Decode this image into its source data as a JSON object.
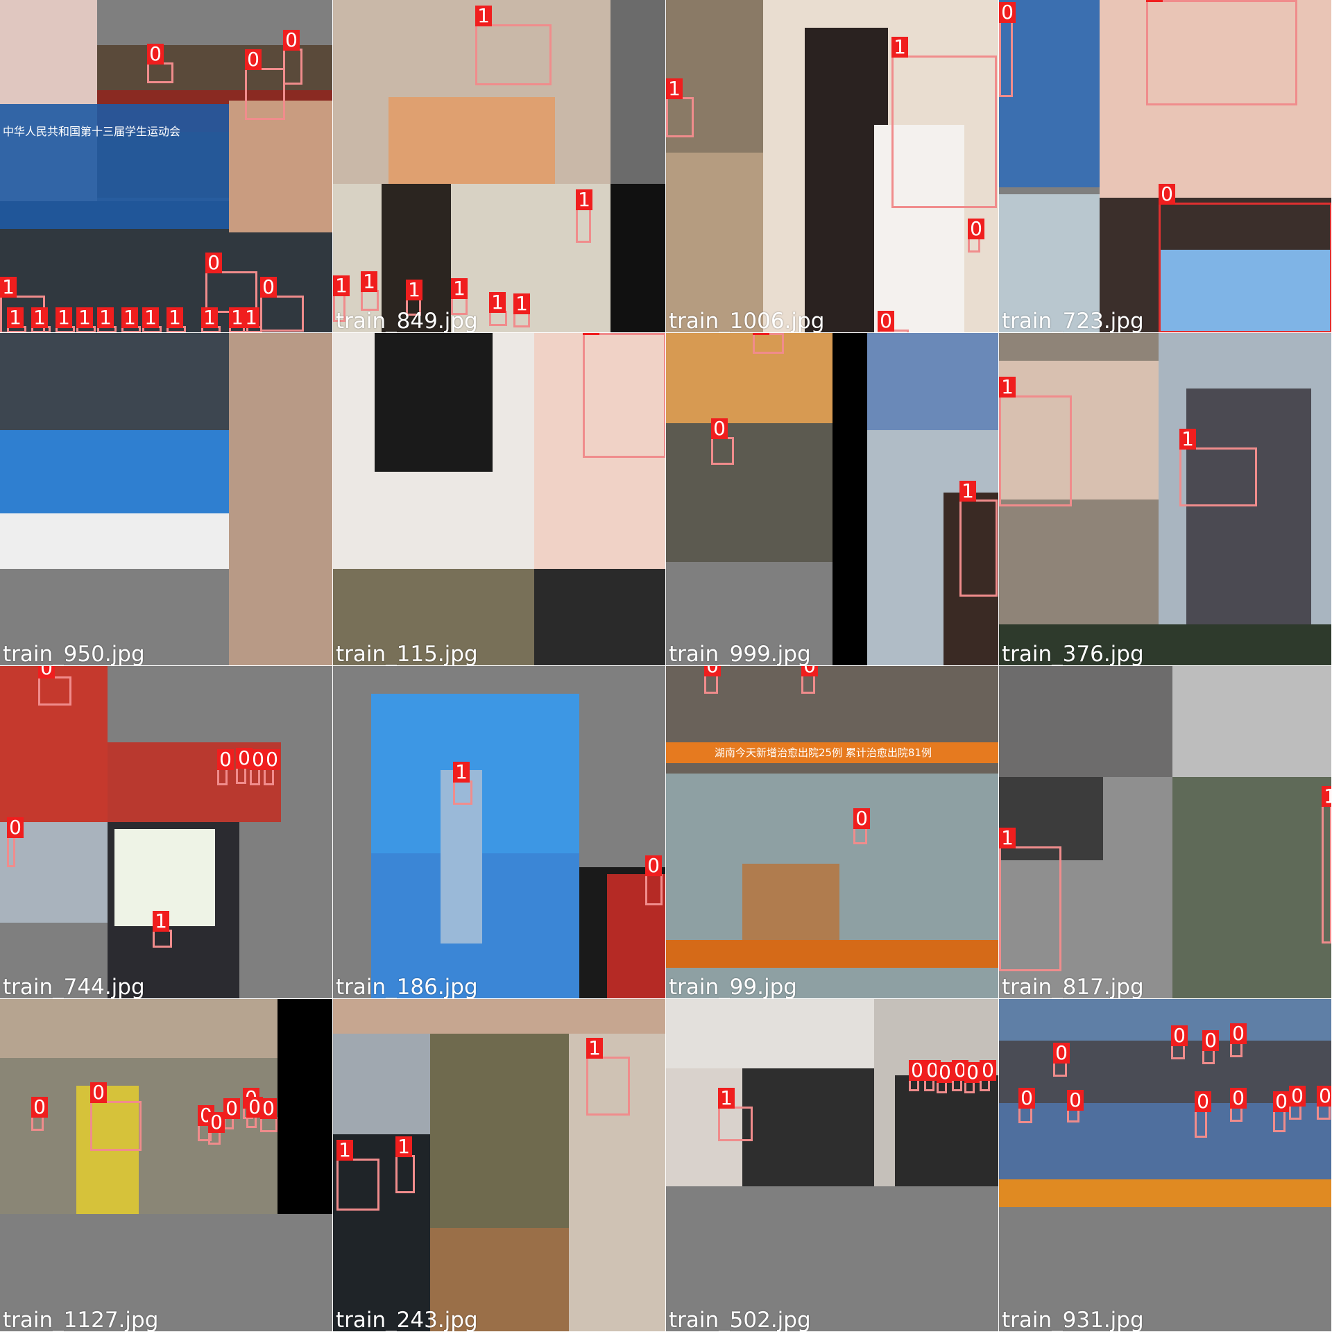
{
  "tiles": [
    {
      "filename": "train_950.jpg",
      "labels": [
        "0",
        "0",
        "0",
        "0",
        "0",
        "1",
        "1",
        "1",
        "1",
        "1",
        "1",
        "1",
        "1",
        "1",
        "1",
        "1",
        "1"
      ],
      "caption": "中华人民共和国第十三届学生运动会"
    },
    {
      "filename": "train_849.jpg",
      "labels": [
        "1",
        "1",
        "1",
        "1",
        "1",
        "1",
        "1",
        "1"
      ]
    },
    {
      "filename": "train_1006.jpg",
      "labels": [
        "1",
        "1",
        "0",
        "0"
      ]
    },
    {
      "filename": "train_723.jpg",
      "labels": [
        "0",
        "1",
        "0"
      ]
    },
    {
      "filename": "train_115.jpg",
      "labels": [
        "1"
      ]
    },
    {
      "filename": "train_999.jpg",
      "labels": [
        "0",
        "0",
        "1"
      ]
    },
    {
      "filename": "train_376.jpg",
      "labels": [
        "1",
        "1"
      ]
    },
    {
      "filename": "train_744.jpg",
      "labels": [
        "0",
        "0",
        "0",
        "0",
        "0",
        "0",
        "1"
      ]
    },
    {
      "filename": "train_186.jpg",
      "labels": [
        "1",
        "0"
      ]
    },
    {
      "filename": "train_99.jpg",
      "labels": [
        "0",
        "0",
        "0"
      ],
      "caption": "湖南今天新增治愈出院25例 累计治愈出院81例"
    },
    {
      "filename": "train_817.jpg",
      "labels": [
        "1",
        "1"
      ]
    },
    {
      "filename": "train_1127.jpg",
      "labels": [
        "0",
        "0",
        "0",
        "0",
        "0",
        "0",
        "0",
        "0"
      ]
    },
    {
      "filename": "train_243.jpg",
      "labels": [
        "1",
        "1",
        "1"
      ]
    },
    {
      "filename": "train_502.jpg",
      "labels": [
        "1",
        "0",
        "0",
        "0",
        "0",
        "0",
        "0"
      ]
    },
    {
      "filename": "train_931.jpg",
      "labels": [
        "0",
        "0",
        "0",
        "0",
        "0",
        "0",
        "0",
        "0",
        "0",
        "0",
        "0"
      ]
    }
  ],
  "colors": {
    "box": "#f08c8c",
    "label_bg": "#f01e1e",
    "label_text": "#ffffff",
    "filler": "#7f7f7f"
  }
}
